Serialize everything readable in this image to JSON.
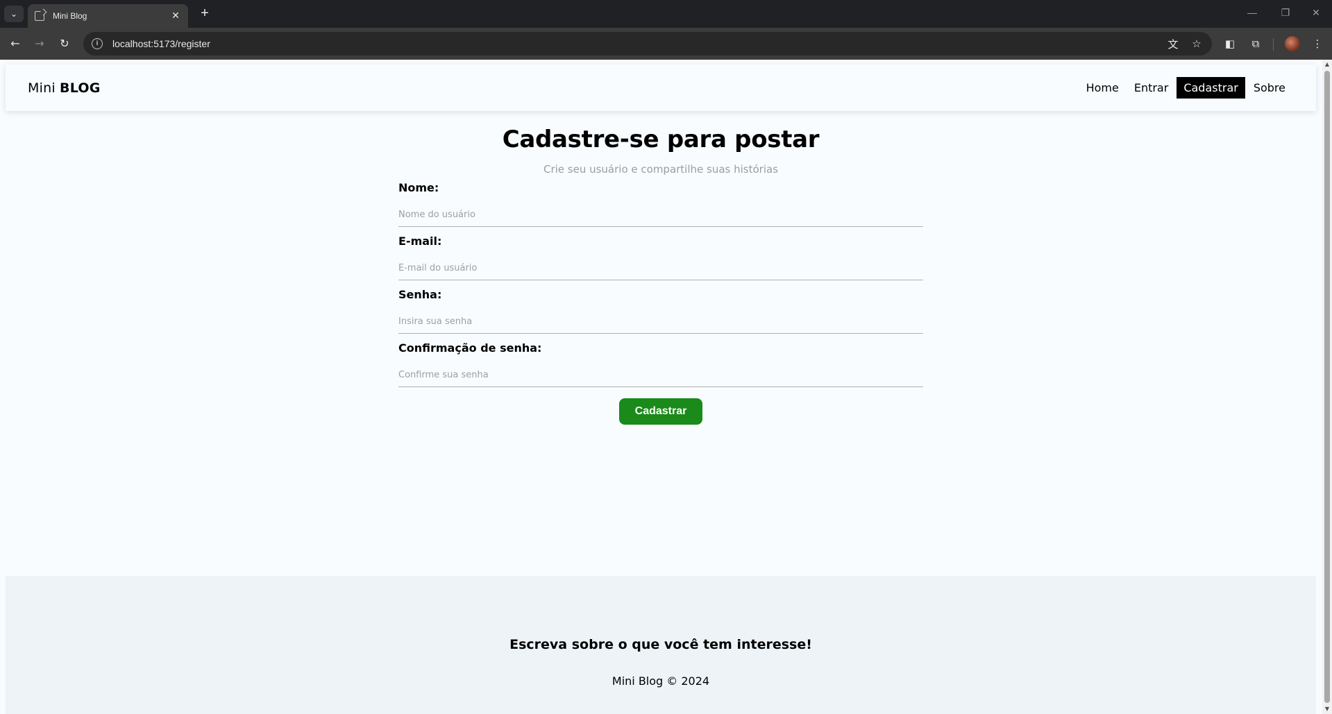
{
  "browser": {
    "tab_title": "Mini Blog",
    "url": "localhost:5173/register",
    "icons": {
      "tab_list": "chevron-down-icon",
      "close_tab": "close-icon",
      "new_tab": "plus-icon",
      "back": "arrow-left-icon",
      "forward": "arrow-right-icon",
      "reload": "reload-icon",
      "site_info": "info-icon",
      "translate": "translate-icon",
      "bookmark": "star-icon",
      "extensions": "puzzle-icon",
      "menu": "kebab-menu-icon"
    }
  },
  "site": {
    "brand_prefix": "Mini",
    "brand_bold": "BLOG",
    "nav": [
      "Home",
      "Entrar",
      "Cadastrar",
      "Sobre"
    ],
    "active_nav": "Cadastrar"
  },
  "register": {
    "title": "Cadastre-se para postar",
    "subtitle": "Crie seu usuário e compartilhe suas histórias",
    "fields": [
      {
        "label": "Nome:",
        "placeholder": "Nome do usuário",
        "value": ""
      },
      {
        "label": "E-mail:",
        "placeholder": "E-mail do usuário",
        "value": ""
      },
      {
        "label": "Senha:",
        "placeholder": "Insira sua senha",
        "value": ""
      },
      {
        "label": "Confirmação de senha:",
        "placeholder": "Confirme sua senha",
        "value": ""
      }
    ],
    "submit_label": "Cadastrar",
    "submit_color": "#1a8a1a"
  },
  "footer": {
    "headline": "Escreva sobre o que você tem interesse!",
    "copyright": "Mini Blog © 2024"
  }
}
